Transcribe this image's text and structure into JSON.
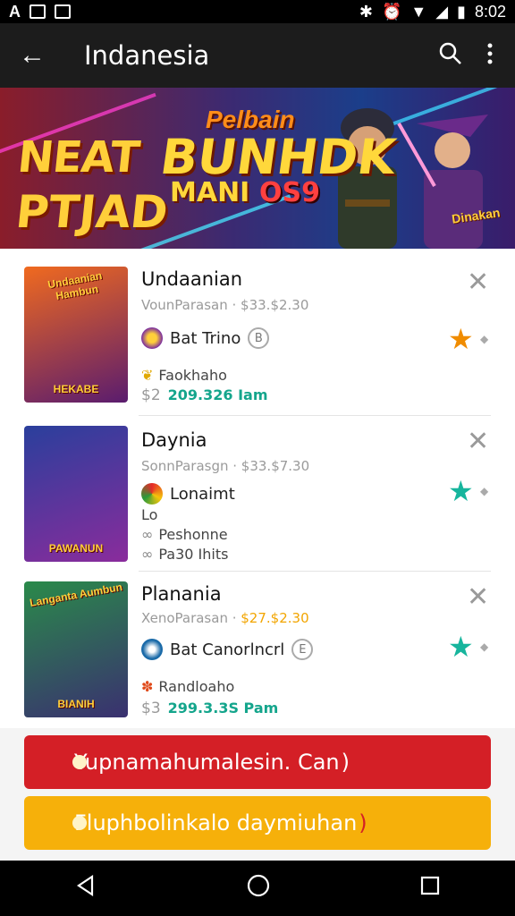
{
  "status_bar": {
    "left_letters": "A",
    "time": "8:02"
  },
  "appbar": {
    "title": "Indanesia"
  },
  "banner": {
    "line1": "NEAT",
    "line2": "PTJAD",
    "line3": "Pelbain",
    "line4": "BUNHDK",
    "line5": "MANI",
    "line6": "OS9",
    "badge": "Dinakan"
  },
  "cards": [
    {
      "name": "Undaanian",
      "vendor": "VounParasan",
      "price": "$33.$2.30",
      "price_highlight": false,
      "feature_name": "Bat Trino",
      "feature_badge": "B",
      "minor_lines": [
        {
          "icon": "wheat-icon",
          "text": "Faokhaho"
        }
      ],
      "money_currency": "$2",
      "money_amount": "209.326 Iam",
      "star_color": "#f08c00",
      "thumb_header": "Undaanian Hambun",
      "thumb_label": "HEKABE",
      "thumb_colors": [
        "#f06a1f",
        "#5a1c6e"
      ]
    },
    {
      "name": "Daynia",
      "vendor": "SonnParasgn",
      "price": "$33.$7.30",
      "price_highlight": false,
      "feature_name": "Lonaimt",
      "feature_badge": "",
      "minor_lines": [
        {
          "icon": "",
          "text": "Lo"
        },
        {
          "icon": "link-icon",
          "text": "Peshonne"
        },
        {
          "icon": "link-icon",
          "text": "Pa30 Ihits"
        }
      ],
      "money_currency": "",
      "money_amount": "",
      "star_color": "#17b59d",
      "thumb_header": "",
      "thumb_label": "PAWANUN",
      "thumb_colors": [
        "#2a3f9c",
        "#8a2c9c"
      ]
    },
    {
      "name": "Planania",
      "vendor": "XenoParasan",
      "price": "$27.$2.30",
      "price_highlight": true,
      "feature_name": "Bat Canorlncrl",
      "feature_badge": "E",
      "minor_lines": [
        {
          "icon": "sparkle-icon",
          "text": "Randloaho"
        }
      ],
      "money_currency": "$3",
      "money_amount": "299.3.3S Pam",
      "star_color": "#17b59d",
      "thumb_header": "Langanta Aumbun",
      "thumb_label": "BIANIH",
      "thumb_colors": [
        "#2a8a4a",
        "#3a3070"
      ]
    }
  ],
  "buttons": {
    "primary_label": "Yupnamahumalesin. Can",
    "primary_color": "#d41f26",
    "secondary_label": "Fluphbolinkalo daymiuhan",
    "secondary_color": "#f6b00a"
  }
}
